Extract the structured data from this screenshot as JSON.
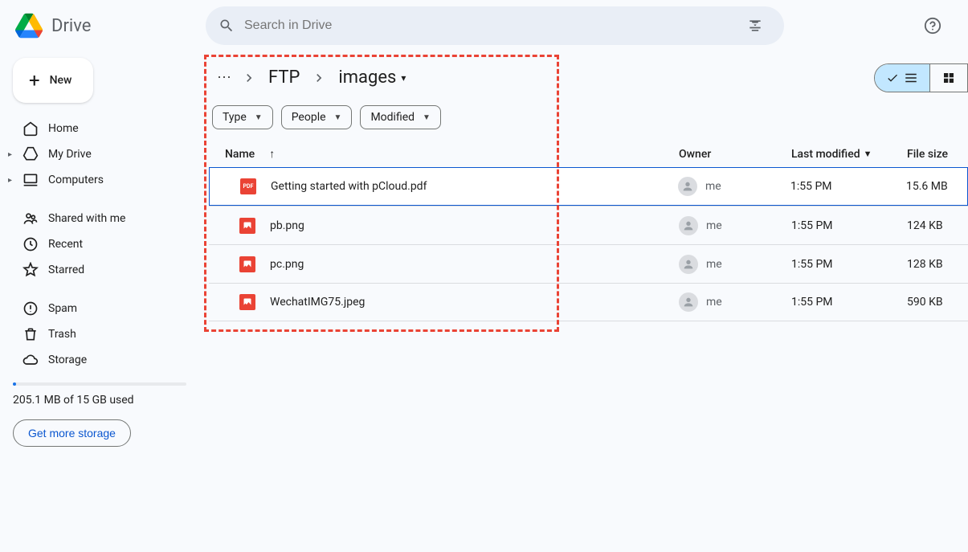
{
  "header": {
    "app_name": "Drive",
    "search_placeholder": "Search in Drive"
  },
  "sidebar": {
    "new_label": "New",
    "items": [
      {
        "label": "Home",
        "icon": "home"
      },
      {
        "label": "My Drive",
        "icon": "drive",
        "expandable": true
      },
      {
        "label": "Computers",
        "icon": "computers",
        "expandable": true
      }
    ],
    "items2": [
      {
        "label": "Shared with me",
        "icon": "shared"
      },
      {
        "label": "Recent",
        "icon": "recent"
      },
      {
        "label": "Starred",
        "icon": "star"
      }
    ],
    "items3": [
      {
        "label": "Spam",
        "icon": "spam"
      },
      {
        "label": "Trash",
        "icon": "trash"
      },
      {
        "label": "Storage",
        "icon": "cloud"
      }
    ],
    "storage_text": "205.1 MB of 15 GB used",
    "get_storage_label": "Get more storage"
  },
  "breadcrumb": {
    "parent": "FTP",
    "current": "images"
  },
  "filters": {
    "type": "Type",
    "people": "People",
    "modified": "Modified"
  },
  "columns": {
    "name": "Name",
    "owner": "Owner",
    "modified": "Last modified",
    "size": "File size"
  },
  "files": [
    {
      "name": "Getting started with pCloud.pdf",
      "type": "pdf",
      "owner": "me",
      "modified": "1:55 PM",
      "size": "15.6 MB",
      "selected": true
    },
    {
      "name": "pb.png",
      "type": "img",
      "owner": "me",
      "modified": "1:55 PM",
      "size": "124 KB"
    },
    {
      "name": "pc.png",
      "type": "img",
      "owner": "me",
      "modified": "1:55 PM",
      "size": "128 KB"
    },
    {
      "name": "WechatIMG75.jpeg",
      "type": "img",
      "owner": "me",
      "modified": "1:55 PM",
      "size": "590 KB"
    }
  ]
}
